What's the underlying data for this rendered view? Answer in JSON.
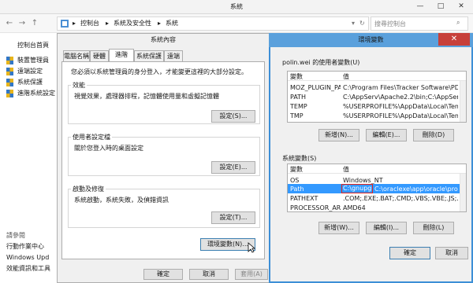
{
  "control_panel": {
    "title": "系統",
    "breadcrumb": [
      "控制台",
      "系統及安全性",
      "系統"
    ],
    "search_placeholder": "搜尋控制台",
    "left_pane": {
      "home": "控制台首頁",
      "links": [
        "裝置管理員",
        "遠端設定",
        "系統保護",
        "進階系統設定"
      ],
      "see_also_title": "請參閱",
      "see_also": [
        "行動作業中心",
        "Windows Upd",
        "效能資訊和工具"
      ]
    }
  },
  "system_properties": {
    "title": "系統內容",
    "tabs": [
      "電腦名稱",
      "硬體",
      "進階",
      "系統保護",
      "遠端"
    ],
    "active_tab": "進階",
    "admin_note": "您必須以系統管理員的身分登入，才能變更這裡的大部分設定。",
    "groups": [
      {
        "title": "效能",
        "desc": "視覺效果，處理器排程，記憶體使用量和虛擬記憶體",
        "button": "設定(S)..."
      },
      {
        "title": "使用者設定檔",
        "desc": "關於您登入時的桌面設定",
        "button": "設定(E)..."
      },
      {
        "title": "啟動及修復",
        "desc": "系統啟動，系統失敗，及偵錯資訊",
        "button": "設定(T)..."
      }
    ],
    "env_button": "環境變數(N)...",
    "ok": "確定",
    "cancel": "取消",
    "apply": "套用(A)"
  },
  "env_vars": {
    "title": "環境變數",
    "user_section_label": "polin.wei 的使用者變數(U)",
    "system_section_label": "系統變數(S)",
    "columns": [
      "變數",
      "值"
    ],
    "user_vars": [
      {
        "name": "MOZ_PLUGIN_PA...",
        "value": "C:\\Program Files\\Tracker Software\\PDF Vi..."
      },
      {
        "name": "PATH",
        "value": "C:\\AppServ\\Apache2.2\\bin;C:\\AppServ\\php..."
      },
      {
        "name": "TEMP",
        "value": "%USERPROFILE%\\AppData\\Local\\Temp"
      },
      {
        "name": "TMP",
        "value": "%USERPROFILE%\\AppData\\Local\\Temp"
      }
    ],
    "system_vars": [
      {
        "name": "OS",
        "value": "Windows_NT"
      },
      {
        "name": "Path",
        "value_highlight": "C:\\gnupg;",
        "value_rest": "C:\\oraclexe\\app\\oracle\\produ..."
      },
      {
        "name": "PATHEXT",
        "value": ".COM;.EXE;.BAT;.CMD;.VBS;.VBE;.JS;.JSE;..."
      },
      {
        "name": "PROCESSOR_AR...",
        "value": "AMD64"
      }
    ],
    "buttons": {
      "new_user": "新增(N)...",
      "edit_user": "編輯(E)...",
      "delete_user": "刪除(D)",
      "new_sys": "新增(W)...",
      "edit_sys": "編輯(I)...",
      "delete_sys": "刪除(L)",
      "ok": "確定",
      "cancel": "取消"
    }
  }
}
